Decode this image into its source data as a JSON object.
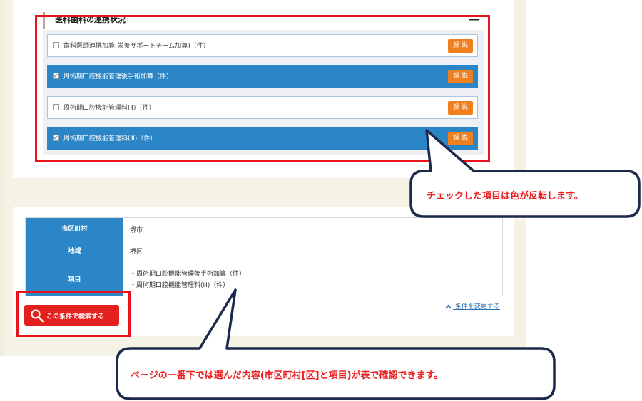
{
  "section": {
    "title": "医科歯科の連携状況",
    "collapse_symbol": "—",
    "items": [
      {
        "label": "歯科医師連携加算(栄養サポートチーム加算)（件）",
        "checked": false,
        "help_label": "解 説"
      },
      {
        "label": "周術期口腔機能管理後手術加算（件）",
        "checked": true,
        "help_label": "解 説"
      },
      {
        "label": "周術期口腔機能管理料(Ⅱ)（件）",
        "checked": false,
        "help_label": "解 説"
      },
      {
        "label": "周術期口腔機能管理料(Ⅲ)（件）",
        "checked": true,
        "help_label": "解 説"
      }
    ]
  },
  "summary": {
    "rows": [
      {
        "header": "市区町村",
        "value": "堺市"
      },
      {
        "header": "地域",
        "value": "堺区"
      },
      {
        "header": "項目",
        "values": [
          "・周術期口腔機能管理後手術加算（件）",
          "・周術期口腔機能管理料(Ⅲ)（件）"
        ]
      }
    ],
    "change_link": "条件を変更する",
    "search_button": "この条件で検索する"
  },
  "callouts": [
    {
      "text": "チェックした項目は色が反転します。"
    },
    {
      "text": "ページの一番下では選んだ内容(市区町村[区]と項目)が表で確認できます。"
    }
  ],
  "colors": {
    "accent_blue": "#2a86c6",
    "help_orange": "#f07f1d",
    "search_red": "#e4201f",
    "highlight_red": "#e8141b",
    "callout_border": "#1b2a4a"
  },
  "icons": {
    "checkbox_checked": "☑",
    "checkbox_unchecked": "☐",
    "search": "search-icon",
    "chevron": "chevron-up-icon"
  }
}
